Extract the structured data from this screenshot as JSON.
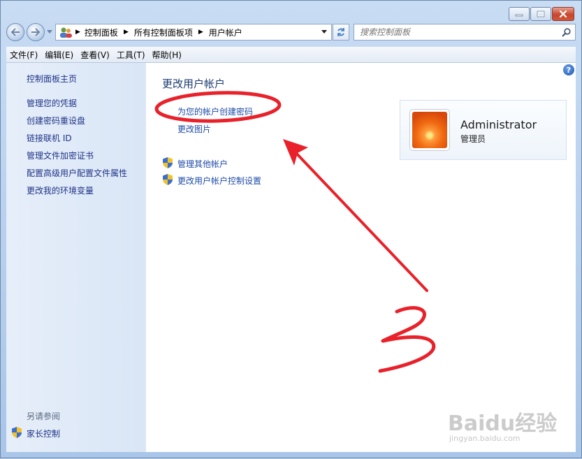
{
  "window": {
    "caption": {
      "minimize": "minimize-icon",
      "maximize": "maximize-icon",
      "close": "close-icon"
    }
  },
  "nav": {
    "breadcrumb": [
      "控制面板",
      "所有控制面板项",
      "用户帐户"
    ],
    "search_placeholder": "搜索控制面板"
  },
  "menu": [
    "文件(F)",
    "编辑(E)",
    "查看(V)",
    "工具(T)",
    "帮助(H)"
  ],
  "sidebar": {
    "home": "控制面板主页",
    "items": [
      "管理您的凭据",
      "创建密码重设盘",
      "链接联机 ID",
      "管理文件加密证书",
      "配置高级用户配置文件属性",
      "更改我的环境变量"
    ],
    "see_also_label": "另请参阅",
    "see_also_items": [
      "家长控制"
    ]
  },
  "main": {
    "title": "更改用户帐户",
    "links": [
      "为您的帐户创建密码",
      "更改图片"
    ],
    "admin_links": [
      "管理其他帐户",
      "更改用户帐户控制设置"
    ]
  },
  "user": {
    "name": "Administrator",
    "role": "管理员"
  },
  "annotation": {
    "number": "3",
    "color": "#e8212a"
  },
  "watermark": {
    "brand": "Baidu经验",
    "url": "jingyan.baidu.com"
  },
  "colors": {
    "link": "#1e4ba8",
    "sidebar_link": "#1e3287",
    "accent": "#4a7cc9"
  }
}
